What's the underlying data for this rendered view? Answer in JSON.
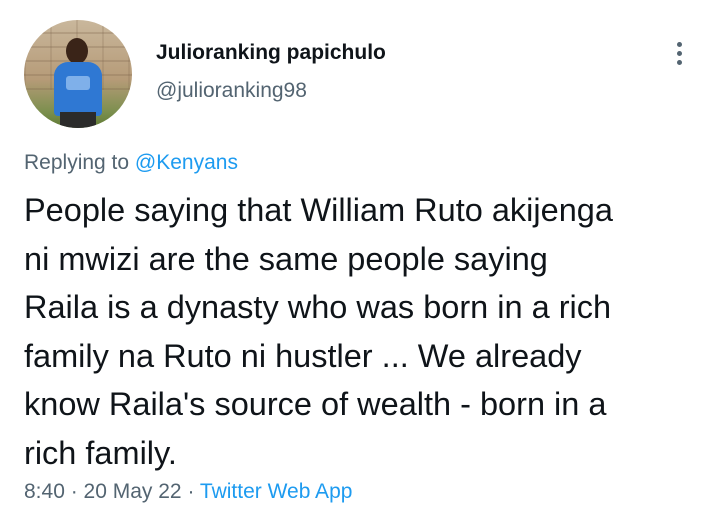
{
  "author": {
    "display_name": "Julioranking papichulo",
    "display_name_rendered": "Julioranking papichulo",
    "handle": "@julioranking98"
  },
  "reply": {
    "prefix": "Replying to ",
    "mention": "@Kenyans"
  },
  "tweet": {
    "lines": [
      "People saying that William Ruto akijenga",
      "ni mwizi are the same people saying",
      "Raila is a dynasty who was born in a rich",
      "family na Ruto ni hustler ... We already",
      "know Raila's source of wealth - born in a",
      "rich family."
    ]
  },
  "meta": {
    "time": "8:40",
    "sep1": " · ",
    "date": "20 May 22",
    "sep2": " · ",
    "source": "Twitter Web App"
  },
  "icons": {
    "more": "more-vertical-icon"
  },
  "colors": {
    "text": "#0f1419",
    "secondary": "#536471",
    "accent": "#1d9bf0"
  }
}
